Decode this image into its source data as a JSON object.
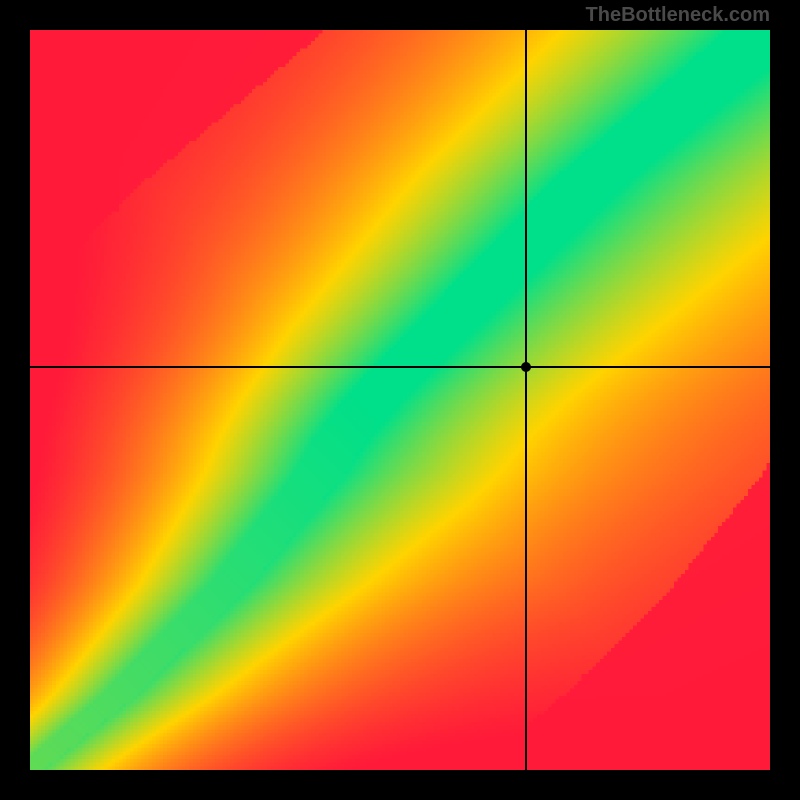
{
  "attribution": "TheBottleneck.com",
  "chart_data": {
    "type": "heatmap",
    "title": "",
    "xlabel": "",
    "ylabel": "",
    "xlim": [
      0,
      1
    ],
    "ylim": [
      0,
      1
    ],
    "grid": false,
    "color_scale": {
      "low": "#ff1a3a",
      "mid": "#ffd400",
      "high": "#00e08a",
      "note": "red→yellow→green; green = good match, red = severe bottleneck"
    },
    "crosshair": {
      "x": 0.67,
      "y": 0.545
    },
    "marker": {
      "x": 0.67,
      "y": 0.545
    },
    "ridge": {
      "note": "approximate x positions of the green optimal band at sampled y's (fractions of plot, origin bottom-left)",
      "points": [
        {
          "y": 0.0,
          "x": 0.0
        },
        {
          "y": 0.05,
          "x": 0.06
        },
        {
          "y": 0.1,
          "x": 0.12
        },
        {
          "y": 0.15,
          "x": 0.17
        },
        {
          "y": 0.2,
          "x": 0.22
        },
        {
          "y": 0.25,
          "x": 0.27
        },
        {
          "y": 0.3,
          "x": 0.31
        },
        {
          "y": 0.35,
          "x": 0.35
        },
        {
          "y": 0.4,
          "x": 0.39
        },
        {
          "y": 0.45,
          "x": 0.42
        },
        {
          "y": 0.5,
          "x": 0.46
        },
        {
          "y": 0.55,
          "x": 0.51
        },
        {
          "y": 0.6,
          "x": 0.56
        },
        {
          "y": 0.65,
          "x": 0.61
        },
        {
          "y": 0.7,
          "x": 0.66
        },
        {
          "y": 0.75,
          "x": 0.71
        },
        {
          "y": 0.8,
          "x": 0.76
        },
        {
          "y": 0.85,
          "x": 0.82
        },
        {
          "y": 0.9,
          "x": 0.88
        },
        {
          "y": 0.95,
          "x": 0.94
        },
        {
          "y": 1.0,
          "x": 1.0
        }
      ]
    },
    "ridge_width": 0.06
  }
}
